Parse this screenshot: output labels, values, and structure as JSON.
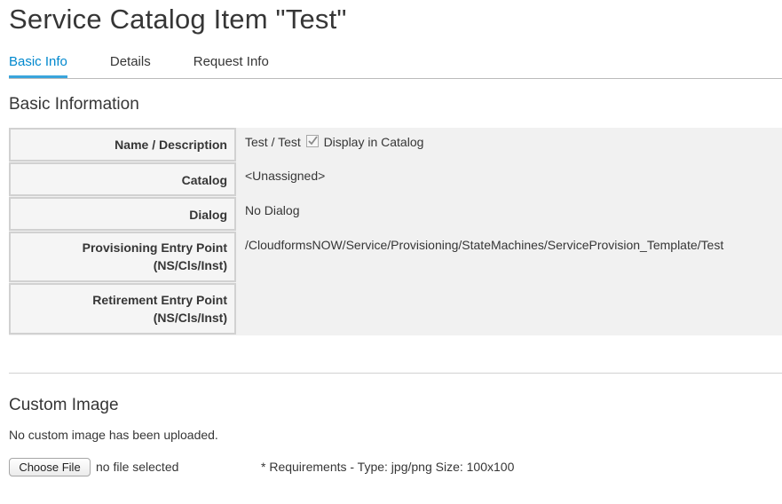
{
  "page": {
    "title": "Service Catalog Item \"Test\""
  },
  "tabs": [
    {
      "label": "Basic Info",
      "active": true
    },
    {
      "label": "Details",
      "active": false
    },
    {
      "label": "Request Info",
      "active": false
    }
  ],
  "basic_info": {
    "heading": "Basic Information",
    "rows": [
      {
        "label_line1": "Name / Description",
        "label_line2": "",
        "value": "Test / Test"
      },
      {
        "label_line1": "Catalog",
        "label_line2": "",
        "value": "<Unassigned>"
      },
      {
        "label_line1": "Dialog",
        "label_line2": "",
        "value": "No Dialog"
      },
      {
        "label_line1": "Provisioning Entry Point",
        "label_line2": "(NS/Cls/Inst)",
        "value": "/CloudformsNOW/Service/Provisioning/StateMachines/ServiceProvision_Template/Test"
      },
      {
        "label_line1": "Retirement Entry Point",
        "label_line2": "(NS/Cls/Inst)",
        "value": ""
      }
    ],
    "display_in_catalog": {
      "label": "Display in Catalog",
      "checked": true
    }
  },
  "custom_image": {
    "heading": "Custom Image",
    "status_text": "No custom image has been uploaded.",
    "file_button_label": "Choose File",
    "file_status": "no file selected",
    "requirements": "* Requirements - Type: jpg/png Size: 100x100"
  },
  "colors": {
    "accent": "#0088ce",
    "tab_underline": "#39a5dc",
    "text": "#363636",
    "label_bg": "#f5f5f5",
    "label_border": "#d1d1d1",
    "table_bg": "#f1f1f1"
  },
  "icons": {
    "checkbox": "checkmark-icon"
  }
}
